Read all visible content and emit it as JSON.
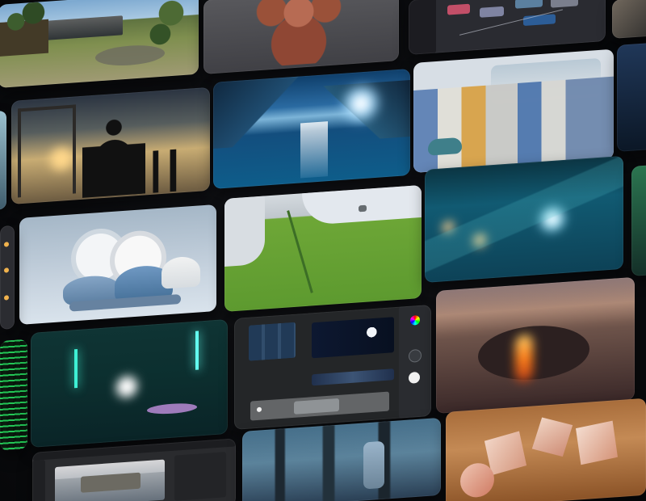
{
  "gallery": {
    "title": "",
    "tiles": [
      {
        "id": "hillside-house-scene",
        "subject": "house-landscape-render"
      },
      {
        "id": "creature-sculpt-scene",
        "subject": "red-creature-sculpt"
      },
      {
        "id": "node-editor-scene",
        "subject": "node-editor-interface"
      },
      {
        "id": "corner-edge-scene",
        "subject": "cropped-interior-scene"
      },
      {
        "id": "sunset-silhouette-scene",
        "subject": "figure-at-sunset"
      },
      {
        "id": "fjord-sunburst-scene",
        "subject": "fjord-with-sun-flare"
      },
      {
        "id": "bedroom-carpet-scene",
        "subject": "patterned-carpet-and-bed"
      },
      {
        "id": "dishware-scene",
        "subject": "stacked-plates-and-bowls"
      },
      {
        "id": "green-car-closeup-scene",
        "subject": "green-car-body-closeup"
      },
      {
        "id": "underwater-lights-scene",
        "subject": "underwater-light-flare"
      },
      {
        "id": "matrix-code-scene",
        "subject": "green-code-screen"
      },
      {
        "id": "teal-neon-room-scene",
        "subject": "teal-neon-interior"
      },
      {
        "id": "compositor-ui-scene",
        "subject": "compositor-interface"
      },
      {
        "id": "lava-crater-scene",
        "subject": "volcanic-lava-crater"
      },
      {
        "id": "app-window-scene",
        "subject": "app-window-with-building"
      },
      {
        "id": "forest-tree-scene",
        "subject": "misty-forest"
      },
      {
        "id": "warm-blocks-scene",
        "subject": "wooden-letter-blocks"
      }
    ]
  }
}
